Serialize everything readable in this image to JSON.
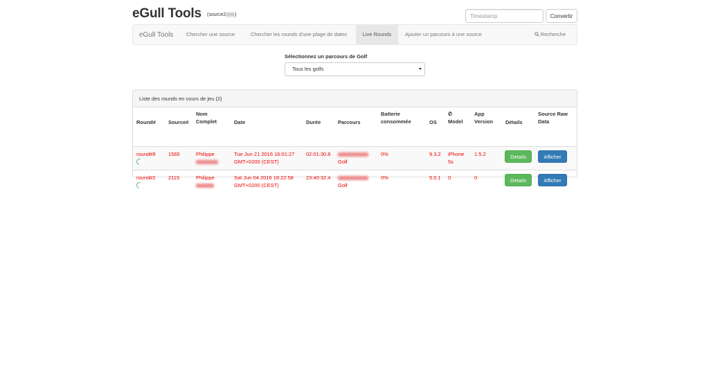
{
  "header": {
    "title": "eGull Tools",
    "subtitle": "(source2",
    "subtitle_end": ")",
    "timestamp_placeholder": "Timestamp",
    "convert_label": "Convertir"
  },
  "navbar": {
    "brand": "eGull Tools",
    "items": [
      {
        "label": "Chercher une source",
        "active": false
      },
      {
        "label": "Chercher les rounds d'une plage de dates",
        "active": false
      },
      {
        "label": "Live Rounds",
        "active": true
      },
      {
        "label": "Ajouter un parcours à une source",
        "active": false
      }
    ],
    "search_label": "Recherche"
  },
  "golf_select": {
    "label": "Sélectionnez un parcours de Golf",
    "value": "Tous les golfs"
  },
  "panel": {
    "title": "Liste des rounds en cours de jeu (2)",
    "columns": {
      "round": "Round#",
      "source": "Source#",
      "name_1": "Nom",
      "name_2": "Complet",
      "date": "Date",
      "duration": "Durée",
      "course": "Parcours",
      "battery_1": "Batterie",
      "battery_2": "consommée",
      "os": "OS",
      "model": "Model",
      "app_1": "App",
      "app_2": "Version",
      "details": "Détails",
      "raw_1": "Source Raw",
      "raw_2": "Data"
    },
    "rows": [
      {
        "round": "round#8",
        "source": "1565",
        "first_name": "Philippe",
        "date_1": "Tue Jun 21 2016 16:01:27",
        "date_2": "GMT+0200 (CEST)",
        "duration": "02:01:30.8",
        "course_2": "Golf",
        "battery": "0%",
        "os": "9.3.2",
        "model_1": "iPhone",
        "model_2": "5s",
        "app_version": "1.5.2",
        "details_label": "Details",
        "raw_label": "Afficher"
      },
      {
        "round": "round#2",
        "source": "2115",
        "first_name": "Philippe",
        "date_1": "Sat Jun 04 2016 18:22:58",
        "date_2": "GMT+0200 (CEST)",
        "duration": "23:40:32.4",
        "course_2": "Golf",
        "battery": "0%",
        "os": "5.0.1",
        "model_1": "0",
        "model_2": "",
        "app_version": "0",
        "details_label": "Details",
        "raw_label": "Afficher"
      }
    ]
  },
  "colors": {
    "row_text": "#ee0000",
    "success": "#5cb85c",
    "primary": "#337ab7"
  }
}
